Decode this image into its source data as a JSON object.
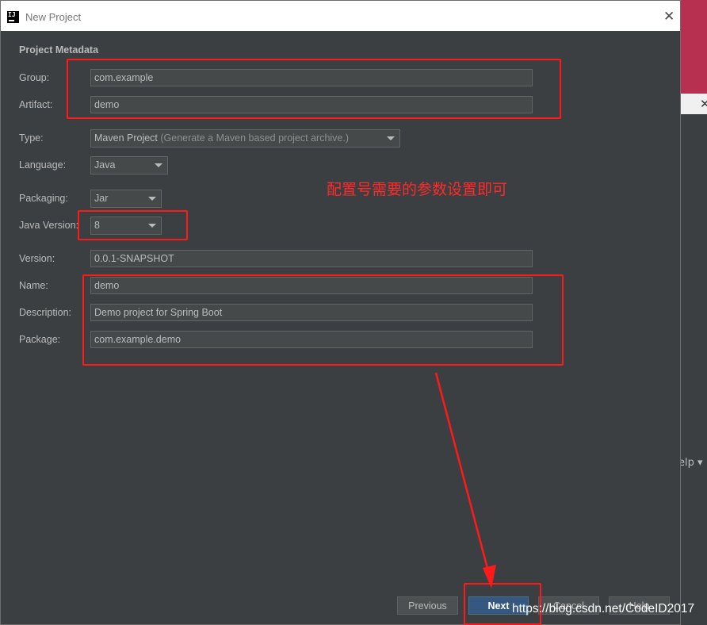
{
  "window": {
    "title": "New Project",
    "app_icon": "IJ"
  },
  "section": {
    "title": "Project Metadata"
  },
  "fields": {
    "group": {
      "label": "Group:",
      "value": "com.example"
    },
    "artifact": {
      "label": "Artifact:",
      "value": "demo"
    },
    "type": {
      "label": "Type:",
      "value": "Maven Project",
      "hint": "(Generate a Maven based project archive.)"
    },
    "language": {
      "label": "Language:",
      "value": "Java"
    },
    "packaging": {
      "label": "Packaging:",
      "value": "Jar"
    },
    "java_version": {
      "label": "Java Version:",
      "value": "8"
    },
    "version": {
      "label": "Version:",
      "value": "0.0.1-SNAPSHOT"
    },
    "name": {
      "label": "Name:",
      "value": "demo"
    },
    "description": {
      "label": "Description:",
      "value": "Demo project for Spring Boot"
    },
    "package": {
      "label": "Package:",
      "value": "com.example.demo"
    }
  },
  "annotation": {
    "text": "配置号需要的参数设置即可",
    "color": "#ff2a2a"
  },
  "buttons": {
    "previous": "Previous",
    "next": "Next",
    "cancel": "Cancel",
    "help": "Help"
  },
  "background_window": {
    "help_label": "elp"
  },
  "watermark": "https://blog.csdn.net/CodeID2017",
  "colors": {
    "dialog_bg": "#3c3f41",
    "field_bg": "#45494a",
    "primary_button": "#365880",
    "desktop_bg": "#b8304f"
  },
  "icons": {
    "close": "close-icon",
    "dropdown": "chevron-down-icon"
  }
}
